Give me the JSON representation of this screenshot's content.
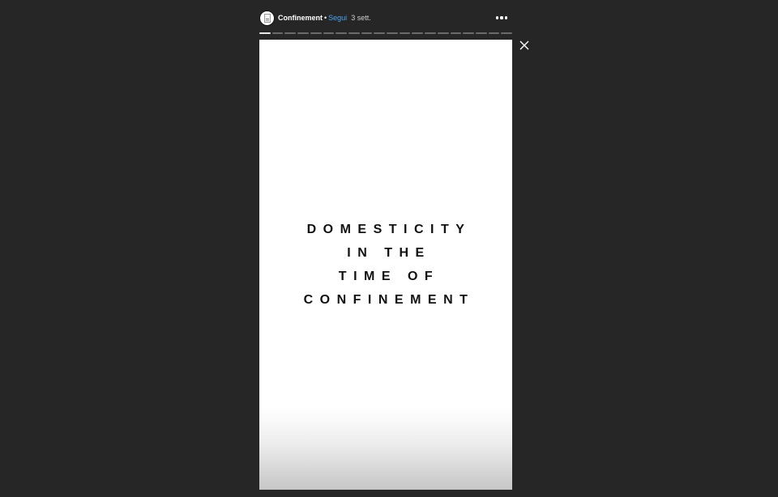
{
  "header": {
    "username": "Confinement",
    "separator": "•",
    "follow_label": "Segui",
    "time_label": "3 sett.",
    "avatar_icon": "document-icon",
    "more_icon": "more-options-icon"
  },
  "progress": {
    "segments": 20,
    "completed": 1
  },
  "close_icon": "close-icon",
  "story": {
    "lines": [
      "DOMESTICITY",
      "IN THE",
      "TIME OF",
      "CONFINEMENT"
    ]
  },
  "colors": {
    "background": "#262626",
    "link": "#4aa3f0",
    "text": "#111111"
  }
}
